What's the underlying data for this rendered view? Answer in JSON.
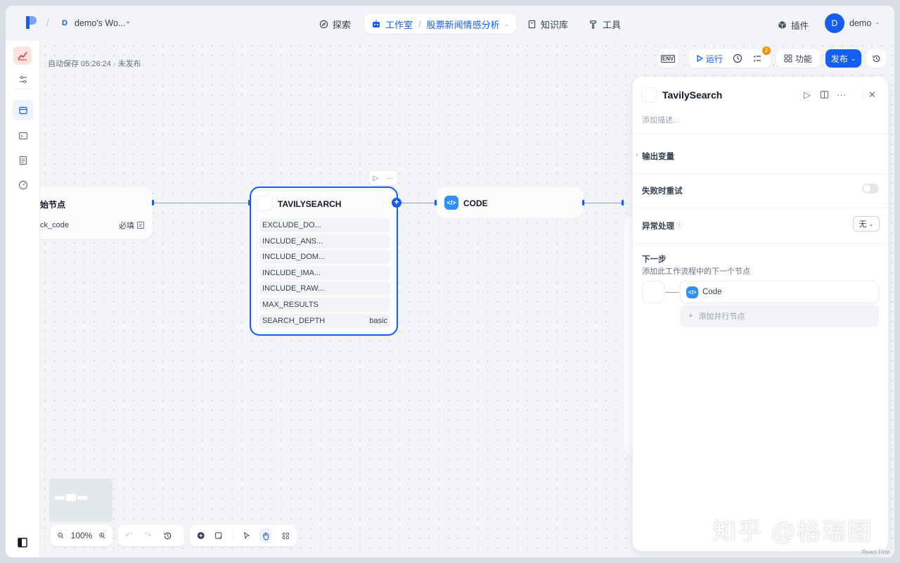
{
  "topbar": {
    "workspace_initial": "D",
    "workspace_name": "demo's Wo...",
    "nav": {
      "explore": "探索",
      "studio": "工作室",
      "app_name": "股票新闻情感分析",
      "knowledge": "知识库",
      "tools": "工具"
    },
    "plugins": "插件",
    "user_initial": "D",
    "user_name": "demo"
  },
  "canvas": {
    "autosave": "自动保存 05:26:24 · 未发布",
    "start_node": {
      "title": "始节点",
      "var_name": "ck_code",
      "var_required": "必填"
    },
    "tavily_node": {
      "title": "TAVILYSEARCH",
      "vars": [
        {
          "name": "EXCLUDE_DO...",
          "value": ""
        },
        {
          "name": "INCLUDE_ANS...",
          "value": ""
        },
        {
          "name": "INCLUDE_DOM...",
          "value": ""
        },
        {
          "name": "INCLUDE_IMA...",
          "value": ""
        },
        {
          "name": "INCLUDE_RAW...",
          "value": ""
        },
        {
          "name": "MAX_RESULTS",
          "value": ""
        },
        {
          "name": "SEARCH_DEPTH",
          "value": "basic"
        }
      ]
    },
    "code_node": {
      "title": "CODE",
      "icon": "</>"
    }
  },
  "toolbar": {
    "env": "ENV",
    "run": "运行",
    "features": "功能",
    "publish": "发布",
    "checklist_count": "2"
  },
  "panel": {
    "title": "TavilySearch",
    "desc_placeholder": "添加描述...",
    "output_vars": "输出变量",
    "retry_on_fail": "失败时重试",
    "error_handling": "异常处理",
    "error_value": "无",
    "next_step": "下一步",
    "next_step_sub": "添加此工作流程中的下一个节点",
    "next_node": "Code",
    "add_parallel": "添加并行节点"
  },
  "bottom": {
    "zoom": "100%"
  },
  "watermark": {
    "text": "知乎 @格瑞图",
    "sub": "React Flow"
  },
  "colors": {
    "accent": "#155eef",
    "code_icon": "#2e90fa",
    "badge": "#f79009"
  }
}
